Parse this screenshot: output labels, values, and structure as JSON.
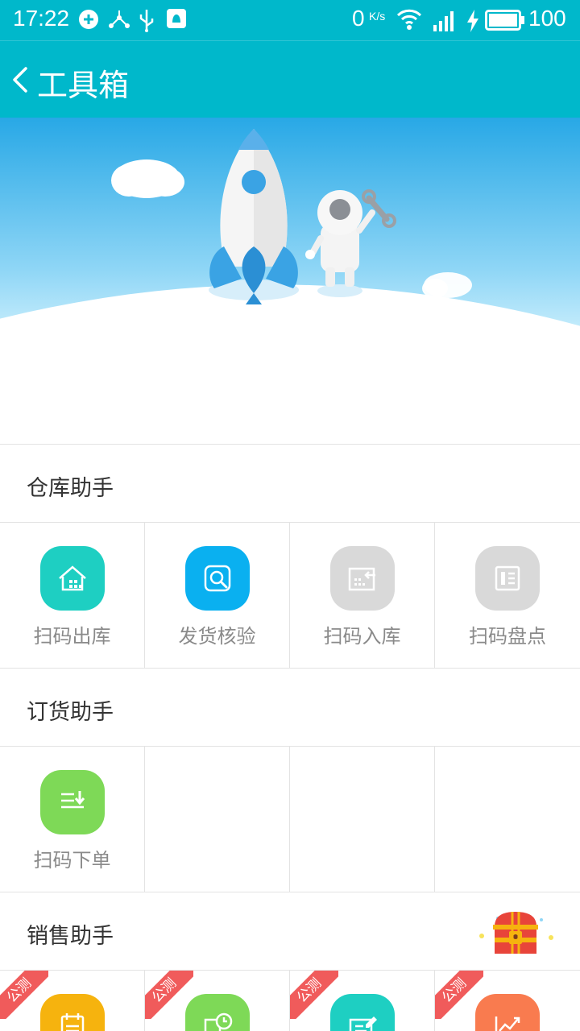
{
  "status_bar": {
    "time": "17:22",
    "net_speed": "0",
    "net_speed_unit": "K/s",
    "battery_level": "100"
  },
  "app_bar": {
    "title": "工具箱"
  },
  "sections": [
    {
      "title": "仓库助手",
      "items": [
        {
          "label": "扫码出库",
          "icon": "warehouse-out-icon",
          "color": "#1ecfc2"
        },
        {
          "label": "发货核验",
          "icon": "delivery-verify-icon",
          "color": "#0ab0f0"
        },
        {
          "label": "扫码入库",
          "icon": "warehouse-in-icon",
          "color": "#d9d9d9"
        },
        {
          "label": "扫码盘点",
          "icon": "inventory-icon",
          "color": "#d9d9d9"
        }
      ]
    },
    {
      "title": "订货助手",
      "items": [
        {
          "label": "扫码下单",
          "icon": "order-download-icon",
          "color": "#7ed957"
        }
      ]
    },
    {
      "title": "销售助手",
      "items": [
        {
          "ribbon": "公测",
          "icon": "calendar-icon",
          "color": "#f6b30e"
        },
        {
          "ribbon": "公测",
          "icon": "clock-list-icon",
          "color": "#7ed957"
        },
        {
          "ribbon": "公测",
          "icon": "edit-form-icon",
          "color": "#1ecfc2"
        },
        {
          "ribbon": "公测",
          "icon": "trend-chart-icon",
          "color": "#f97b4f"
        }
      ]
    }
  ],
  "colors": {
    "brand": "#00b8cb",
    "ribbon": "#f05b5b",
    "divider": "#e3e3e3"
  }
}
